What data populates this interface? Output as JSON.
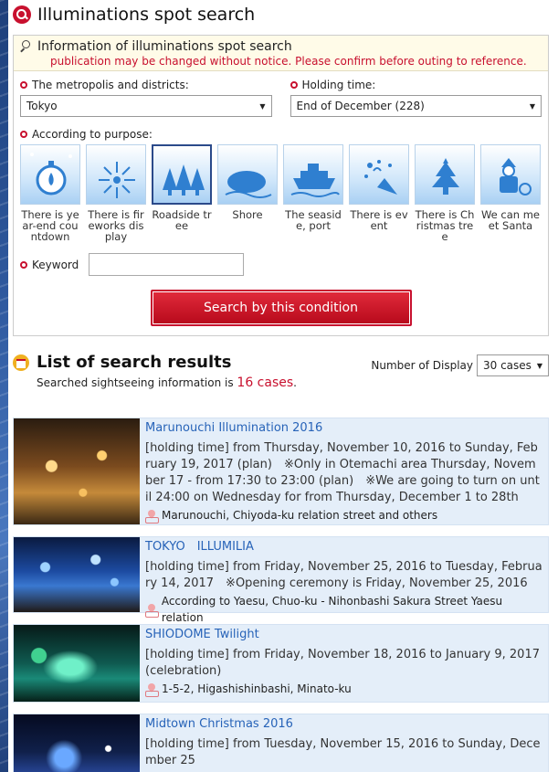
{
  "page": {
    "title": "Illuminations spot search"
  },
  "search": {
    "header_title": "Information of illuminations spot search",
    "notice": "publication may be changed without notice. Please confirm before outing to reference.",
    "region_label": "The metropolis and districts:",
    "region_value": "Tokyo",
    "time_label": "Holding time:",
    "time_value": "End of December (228)",
    "purpose_label": "According to purpose:",
    "purposes": [
      {
        "label": "There is year-end countdown",
        "icon": "stopwatch-icon",
        "selected": false
      },
      {
        "label": "There is fireworks display",
        "icon": "fireworks-icon",
        "selected": false
      },
      {
        "label": "Roadside tree",
        "icon": "trees-icon",
        "selected": true
      },
      {
        "label": "Shore",
        "icon": "shore-icon",
        "selected": false
      },
      {
        "label": "The seaside, port",
        "icon": "ship-icon",
        "selected": false
      },
      {
        "label": "There is event",
        "icon": "party-popper-icon",
        "selected": false
      },
      {
        "label": "There is Christmas tree",
        "icon": "christmas-tree-icon",
        "selected": false
      },
      {
        "label": "We can meet Santa",
        "icon": "santa-icon",
        "selected": false
      }
    ],
    "keyword_label": "Keyword",
    "keyword_value": "",
    "button_label": "Search by this condition"
  },
  "results": {
    "title": "List of search results",
    "summary_prefix": "Searched sightseeing information is ",
    "summary_count": "16 cases",
    "summary_suffix": ".",
    "display_label": "Number of Display",
    "display_value": "30 cases",
    "items": [
      {
        "title": "Marunouchi Illumination 2016",
        "text": "[holding time] from Thursday, November 10, 2016 to Sunday, February 19, 2017 (plan)　※Only in Otemachi area Thursday, November 17 - from 17:30 to 23:00 (plan)　※We are going to turn on until 24:00 on Wednesday for from Thursday, December 1 to 28th",
        "address": "Marunouchi, Chiyoda-ku relation street and others"
      },
      {
        "title": "TOKYO　ILLUMILIA",
        "text": "[holding time] from Friday, November 25, 2016 to Tuesday, February 14, 2017　※Opening ceremony is Friday, November 25, 2016",
        "address": "According to Yaesu, Chuo-ku - Nihonbashi Sakura Street Yaesu relation"
      },
      {
        "title": "SHIODOME Twilight",
        "text": "[holding time] from Friday, November 18, 2016 to January 9, 2017 (celebration)",
        "address": "1-5-2, Higashishinbashi, Minato-ku"
      },
      {
        "title": "Midtown Christmas 2016",
        "text": "[holding time] from Tuesday, November 15, 2016 to Sunday, December 25",
        "address": ""
      }
    ]
  },
  "colors": {
    "accent": "#c8102e",
    "link": "#2763b8",
    "result_bg": "#e4eef9"
  }
}
